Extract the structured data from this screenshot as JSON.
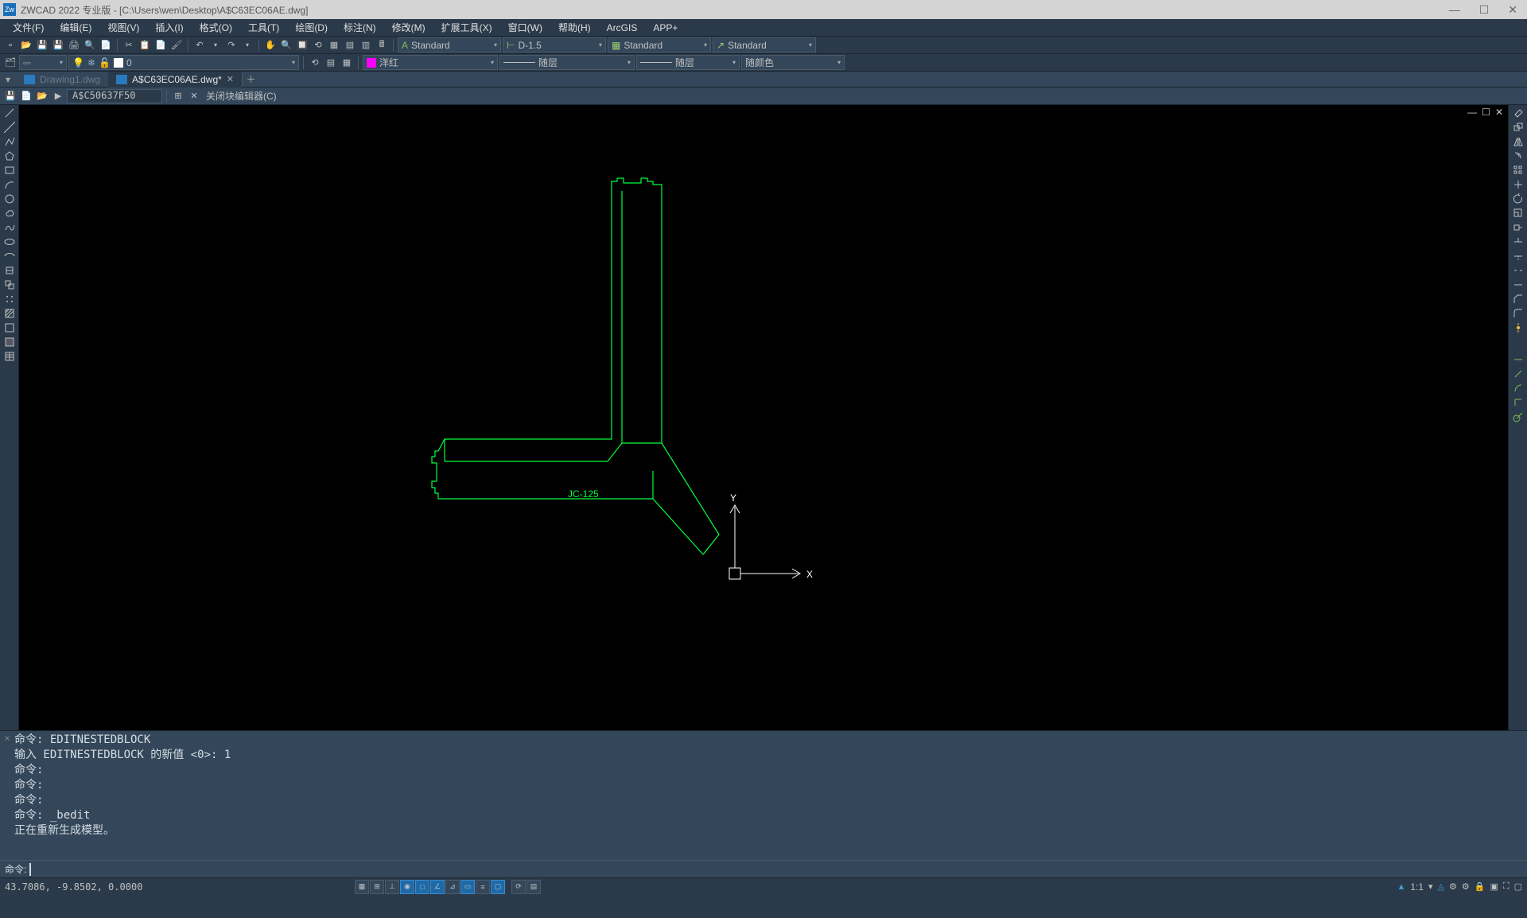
{
  "title": "ZWCAD 2022 专业版 - [C:\\Users\\wen\\Desktop\\A$C63EC06AE.dwg]",
  "menus": [
    "文件(F)",
    "编辑(E)",
    "视图(V)",
    "插入(I)",
    "格式(O)",
    "工具(T)",
    "绘图(D)",
    "标注(N)",
    "修改(M)",
    "扩展工具(X)",
    "窗口(W)",
    "帮助(H)",
    "ArcGIS",
    "APP+"
  ],
  "toolbar1_dropdowns": {
    "text_style": "Standard",
    "dim_style": "D-1.5",
    "table_style": "Standard",
    "leader_style": "Standard"
  },
  "toolbar2_dropdowns": {
    "layer": "0",
    "color_name": "洋红",
    "color_hex": "#ff00ff",
    "linetype": "随层",
    "lineweight": "随层",
    "plot_style": "随颜色"
  },
  "tabs": {
    "inactive": "Drawing1.dwg",
    "active": "A$C63EC06AE.dwg*"
  },
  "block_editor": {
    "block_name": "A$C50637F50",
    "close_label": "关闭块编辑器(C)"
  },
  "drawing_label": "JC-125",
  "ucs": {
    "x": "X",
    "y": "Y"
  },
  "command_history": "命令: EDITNESTEDBLOCK\n输入 EDITNESTEDBLOCK 的新值 <0>: 1\n命令:\n命令:\n命令:\n命令: _bedit\n正在重新生成模型。",
  "command_prompt": "命令:",
  "status": {
    "coords": "43.7086, -9.8502, 0.0000",
    "scale": "1:1"
  }
}
